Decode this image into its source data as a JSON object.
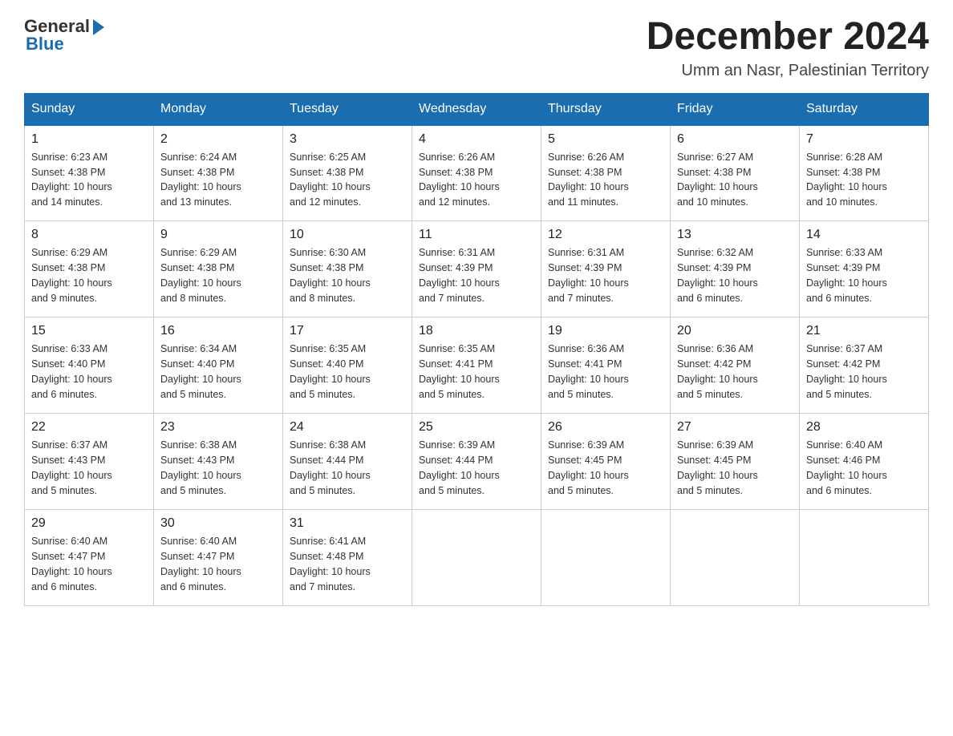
{
  "logo": {
    "general": "General",
    "blue": "Blue"
  },
  "header": {
    "month_year": "December 2024",
    "location": "Umm an Nasr, Palestinian Territory"
  },
  "days_of_week": [
    "Sunday",
    "Monday",
    "Tuesday",
    "Wednesday",
    "Thursday",
    "Friday",
    "Saturday"
  ],
  "weeks": [
    [
      {
        "day": "1",
        "sunrise": "6:23 AM",
        "sunset": "4:38 PM",
        "daylight": "10 hours and 14 minutes."
      },
      {
        "day": "2",
        "sunrise": "6:24 AM",
        "sunset": "4:38 PM",
        "daylight": "10 hours and 13 minutes."
      },
      {
        "day": "3",
        "sunrise": "6:25 AM",
        "sunset": "4:38 PM",
        "daylight": "10 hours and 12 minutes."
      },
      {
        "day": "4",
        "sunrise": "6:26 AM",
        "sunset": "4:38 PM",
        "daylight": "10 hours and 12 minutes."
      },
      {
        "day": "5",
        "sunrise": "6:26 AM",
        "sunset": "4:38 PM",
        "daylight": "10 hours and 11 minutes."
      },
      {
        "day": "6",
        "sunrise": "6:27 AM",
        "sunset": "4:38 PM",
        "daylight": "10 hours and 10 minutes."
      },
      {
        "day": "7",
        "sunrise": "6:28 AM",
        "sunset": "4:38 PM",
        "daylight": "10 hours and 10 minutes."
      }
    ],
    [
      {
        "day": "8",
        "sunrise": "6:29 AM",
        "sunset": "4:38 PM",
        "daylight": "10 hours and 9 minutes."
      },
      {
        "day": "9",
        "sunrise": "6:29 AM",
        "sunset": "4:38 PM",
        "daylight": "10 hours and 8 minutes."
      },
      {
        "day": "10",
        "sunrise": "6:30 AM",
        "sunset": "4:38 PM",
        "daylight": "10 hours and 8 minutes."
      },
      {
        "day": "11",
        "sunrise": "6:31 AM",
        "sunset": "4:39 PM",
        "daylight": "10 hours and 7 minutes."
      },
      {
        "day": "12",
        "sunrise": "6:31 AM",
        "sunset": "4:39 PM",
        "daylight": "10 hours and 7 minutes."
      },
      {
        "day": "13",
        "sunrise": "6:32 AM",
        "sunset": "4:39 PM",
        "daylight": "10 hours and 6 minutes."
      },
      {
        "day": "14",
        "sunrise": "6:33 AM",
        "sunset": "4:39 PM",
        "daylight": "10 hours and 6 minutes."
      }
    ],
    [
      {
        "day": "15",
        "sunrise": "6:33 AM",
        "sunset": "4:40 PM",
        "daylight": "10 hours and 6 minutes."
      },
      {
        "day": "16",
        "sunrise": "6:34 AM",
        "sunset": "4:40 PM",
        "daylight": "10 hours and 5 minutes."
      },
      {
        "day": "17",
        "sunrise": "6:35 AM",
        "sunset": "4:40 PM",
        "daylight": "10 hours and 5 minutes."
      },
      {
        "day": "18",
        "sunrise": "6:35 AM",
        "sunset": "4:41 PM",
        "daylight": "10 hours and 5 minutes."
      },
      {
        "day": "19",
        "sunrise": "6:36 AM",
        "sunset": "4:41 PM",
        "daylight": "10 hours and 5 minutes."
      },
      {
        "day": "20",
        "sunrise": "6:36 AM",
        "sunset": "4:42 PM",
        "daylight": "10 hours and 5 minutes."
      },
      {
        "day": "21",
        "sunrise": "6:37 AM",
        "sunset": "4:42 PM",
        "daylight": "10 hours and 5 minutes."
      }
    ],
    [
      {
        "day": "22",
        "sunrise": "6:37 AM",
        "sunset": "4:43 PM",
        "daylight": "10 hours and 5 minutes."
      },
      {
        "day": "23",
        "sunrise": "6:38 AM",
        "sunset": "4:43 PM",
        "daylight": "10 hours and 5 minutes."
      },
      {
        "day": "24",
        "sunrise": "6:38 AM",
        "sunset": "4:44 PM",
        "daylight": "10 hours and 5 minutes."
      },
      {
        "day": "25",
        "sunrise": "6:39 AM",
        "sunset": "4:44 PM",
        "daylight": "10 hours and 5 minutes."
      },
      {
        "day": "26",
        "sunrise": "6:39 AM",
        "sunset": "4:45 PM",
        "daylight": "10 hours and 5 minutes."
      },
      {
        "day": "27",
        "sunrise": "6:39 AM",
        "sunset": "4:45 PM",
        "daylight": "10 hours and 5 minutes."
      },
      {
        "day": "28",
        "sunrise": "6:40 AM",
        "sunset": "4:46 PM",
        "daylight": "10 hours and 6 minutes."
      }
    ],
    [
      {
        "day": "29",
        "sunrise": "6:40 AM",
        "sunset": "4:47 PM",
        "daylight": "10 hours and 6 minutes."
      },
      {
        "day": "30",
        "sunrise": "6:40 AM",
        "sunset": "4:47 PM",
        "daylight": "10 hours and 6 minutes."
      },
      {
        "day": "31",
        "sunrise": "6:41 AM",
        "sunset": "4:48 PM",
        "daylight": "10 hours and 7 minutes."
      },
      null,
      null,
      null,
      null
    ]
  ],
  "labels": {
    "sunrise": "Sunrise:",
    "sunset": "Sunset:",
    "daylight": "Daylight:"
  }
}
